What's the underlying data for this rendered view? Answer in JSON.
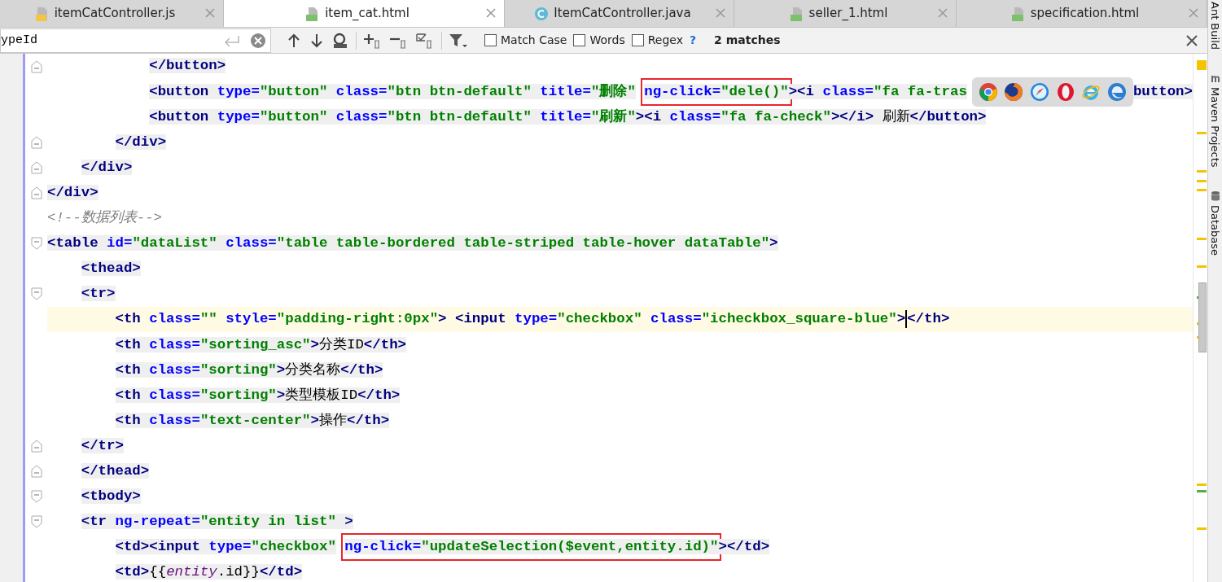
{
  "tabs": [
    {
      "label": "itemCatController.js",
      "kind": "script",
      "selected": false
    },
    {
      "label": "item_cat.html",
      "kind": "markup",
      "selected": true
    },
    {
      "label": "ItemCatController.java",
      "kind": "class",
      "selected": false
    },
    {
      "label": "seller_1.html",
      "kind": "markup",
      "selected": false
    },
    {
      "label": "specification.html",
      "kind": "markup",
      "selected": false
    }
  ],
  "find_bar": {
    "value": "ypeId",
    "options": [
      {
        "label": "Match Case",
        "checked": false
      },
      {
        "label": "Words",
        "checked": false
      },
      {
        "label": "Regex",
        "checked": false
      }
    ],
    "help": "?",
    "result": "2 matches"
  },
  "code_lines": [
    {
      "fold_start": false,
      "fold_end": true,
      "current": false,
      "tokens": [
        {
          "kind": "tag",
          "text": "            </button>"
        }
      ]
    },
    {
      "fold_start": false,
      "fold_end": false,
      "current": false,
      "tokens": [
        {
          "kind": "tag",
          "text": "            <button"
        },
        {
          "kind": "attr",
          "text": " type="
        },
        {
          "kind": "value",
          "text": "\"button\""
        },
        {
          "kind": "attr",
          "text": " class="
        },
        {
          "kind": "value",
          "text": "\"btn btn-default\""
        },
        {
          "kind": "attr",
          "text": " title="
        },
        {
          "kind": "value",
          "text": "\"删除\""
        },
        {
          "kind": "box",
          "tokens": [
            {
              "kind": "attr",
              "text": "ng-click="
            },
            {
              "kind": "value",
              "text": "\"dele()\""
            }
          ]
        },
        {
          "kind": "tag",
          "text": "><i"
        },
        {
          "kind": "attr",
          "text": " class="
        },
        {
          "kind": "value",
          "text": "\"fa fa-tras"
        },
        {
          "kind": "popup"
        },
        {
          "kind": "tag",
          "text": "button>"
        }
      ]
    },
    {
      "fold_start": false,
      "fold_end": false,
      "current": false,
      "tokens": [
        {
          "kind": "tag",
          "text": "            <button"
        },
        {
          "kind": "attr",
          "text": " type="
        },
        {
          "kind": "value",
          "text": "\"button\""
        },
        {
          "kind": "attr",
          "text": " class="
        },
        {
          "kind": "value",
          "text": "\"btn btn-default\""
        },
        {
          "kind": "attr",
          "text": " title="
        },
        {
          "kind": "value",
          "text": "\"刷新\""
        },
        {
          "kind": "tag",
          "text": "><i"
        },
        {
          "kind": "attr",
          "text": " class="
        },
        {
          "kind": "value",
          "text": "\"fa fa-check\""
        },
        {
          "kind": "tag",
          "text": "></i>"
        },
        {
          "kind": "text",
          "text": " 刷新"
        },
        {
          "kind": "tag",
          "text": "</button>"
        }
      ]
    },
    {
      "fold_start": false,
      "fold_end": true,
      "current": false,
      "tokens": [
        {
          "kind": "tag",
          "text": "        </div>"
        }
      ]
    },
    {
      "fold_start": false,
      "fold_end": true,
      "current": false,
      "tokens": [
        {
          "kind": "tag",
          "text": "    </div>"
        }
      ]
    },
    {
      "fold_start": false,
      "fold_end": true,
      "current": false,
      "tokens": [
        {
          "kind": "tag",
          "text": "</div>"
        }
      ]
    },
    {
      "fold_start": false,
      "fold_end": false,
      "current": false,
      "tokens": [
        {
          "kind": "comment",
          "text": "<!--数据列表-->"
        }
      ]
    },
    {
      "fold_start": true,
      "fold_end": false,
      "current": false,
      "tokens": [
        {
          "kind": "tag",
          "text": "<table"
        },
        {
          "kind": "attr",
          "text": " id="
        },
        {
          "kind": "value",
          "text": "\"dataList\""
        },
        {
          "kind": "attr",
          "text": " class="
        },
        {
          "kind": "value",
          "text": "\"table table-bordered table-striped table-hover dataTable\""
        },
        {
          "kind": "tag",
          "text": ">"
        }
      ]
    },
    {
      "fold_start": false,
      "fold_end": false,
      "current": false,
      "tokens": [
        {
          "kind": "tag",
          "text": "    <thead>"
        }
      ]
    },
    {
      "fold_start": true,
      "fold_end": false,
      "current": false,
      "tokens": [
        {
          "kind": "tag",
          "text": "    <tr>"
        }
      ]
    },
    {
      "fold_start": false,
      "fold_end": false,
      "current": true,
      "tokens": [
        {
          "kind": "tag",
          "text": "        <th"
        },
        {
          "kind": "attr",
          "text": " class="
        },
        {
          "kind": "value",
          "text": "\"\""
        },
        {
          "kind": "attr",
          "text": " style="
        },
        {
          "kind": "value",
          "text": "\"padding-right:0px\""
        },
        {
          "kind": "tag",
          "text": ">"
        },
        {
          "kind": "tag",
          "text": " <input"
        },
        {
          "kind": "attr",
          "text": " type="
        },
        {
          "kind": "value",
          "text": "\"checkbox\""
        },
        {
          "kind": "attr",
          "text": " class="
        },
        {
          "kind": "value",
          "text": "\"icheckbox_square-blue\""
        },
        {
          "kind": "tag",
          "text": ">"
        },
        {
          "kind": "caret"
        },
        {
          "kind": "tag",
          "text": "</th>"
        }
      ]
    },
    {
      "fold_start": false,
      "fold_end": false,
      "current": false,
      "tokens": [
        {
          "kind": "tag",
          "text": "        <th"
        },
        {
          "kind": "attr",
          "text": " class="
        },
        {
          "kind": "value",
          "text": "\"sorting_asc\""
        },
        {
          "kind": "tag",
          "text": ">"
        },
        {
          "kind": "text",
          "text": "分类ID"
        },
        {
          "kind": "tag",
          "text": "</th>"
        }
      ]
    },
    {
      "fold_start": false,
      "fold_end": false,
      "current": false,
      "tokens": [
        {
          "kind": "tag",
          "text": "        <th"
        },
        {
          "kind": "attr",
          "text": " class="
        },
        {
          "kind": "value",
          "text": "\"sorting\""
        },
        {
          "kind": "tag",
          "text": ">"
        },
        {
          "kind": "text",
          "text": "分类名称"
        },
        {
          "kind": "tag",
          "text": "</th>"
        }
      ]
    },
    {
      "fold_start": false,
      "fold_end": false,
      "current": false,
      "tokens": [
        {
          "kind": "tag",
          "text": "        <th"
        },
        {
          "kind": "attr",
          "text": " class="
        },
        {
          "kind": "value",
          "text": "\"sorting\""
        },
        {
          "kind": "tag",
          "text": ">"
        },
        {
          "kind": "text",
          "text": "类型模板ID"
        },
        {
          "kind": "tag",
          "text": "</th>"
        }
      ]
    },
    {
      "fold_start": false,
      "fold_end": false,
      "current": false,
      "tokens": [
        {
          "kind": "tag",
          "text": "        <th"
        },
        {
          "kind": "attr",
          "text": " class="
        },
        {
          "kind": "value",
          "text": "\"text-center\""
        },
        {
          "kind": "tag",
          "text": ">"
        },
        {
          "kind": "text",
          "text": "操作"
        },
        {
          "kind": "tag",
          "text": "</th>"
        }
      ]
    },
    {
      "fold_start": false,
      "fold_end": true,
      "current": false,
      "tokens": [
        {
          "kind": "tag",
          "text": "    </tr>"
        }
      ]
    },
    {
      "fold_start": false,
      "fold_end": true,
      "current": false,
      "tokens": [
        {
          "kind": "tag",
          "text": "    </thead>"
        }
      ]
    },
    {
      "fold_start": true,
      "fold_end": false,
      "current": false,
      "tokens": [
        {
          "kind": "tag",
          "text": "    <tbody>"
        }
      ]
    },
    {
      "fold_start": true,
      "fold_end": false,
      "current": false,
      "tokens": [
        {
          "kind": "tag",
          "text": "    <tr"
        },
        {
          "kind": "attr",
          "text": " ng-repeat="
        },
        {
          "kind": "value",
          "text": "\"entity in list\""
        },
        {
          "kind": "tag",
          "text": " >"
        }
      ]
    },
    {
      "fold_start": false,
      "fold_end": false,
      "current": false,
      "tokens": [
        {
          "kind": "tag",
          "text": "        <td><input"
        },
        {
          "kind": "attr",
          "text": " type="
        },
        {
          "kind": "value",
          "text": "\"checkbox\""
        },
        {
          "kind": "box",
          "tokens": [
            {
              "kind": "attr",
              "text": "ng-click="
            },
            {
              "kind": "value",
              "text": "\"updateSelection($event,entity.id)\""
            }
          ]
        },
        {
          "kind": "tag",
          "text": "></td>"
        }
      ]
    },
    {
      "fold_start": false,
      "fold_end": false,
      "current": false,
      "tokens": [
        {
          "kind": "tag",
          "text": "        <td>"
        },
        {
          "kind": "text",
          "text": "{{"
        },
        {
          "kind": "var",
          "text": "entity"
        },
        {
          "kind": "text",
          "text": ".id}}"
        },
        {
          "kind": "tag",
          "text": "</td>"
        }
      ]
    }
  ],
  "tool_windows": [
    {
      "label": "Ant Build"
    },
    {
      "label": "Maven Projects"
    },
    {
      "label": "Database"
    }
  ]
}
